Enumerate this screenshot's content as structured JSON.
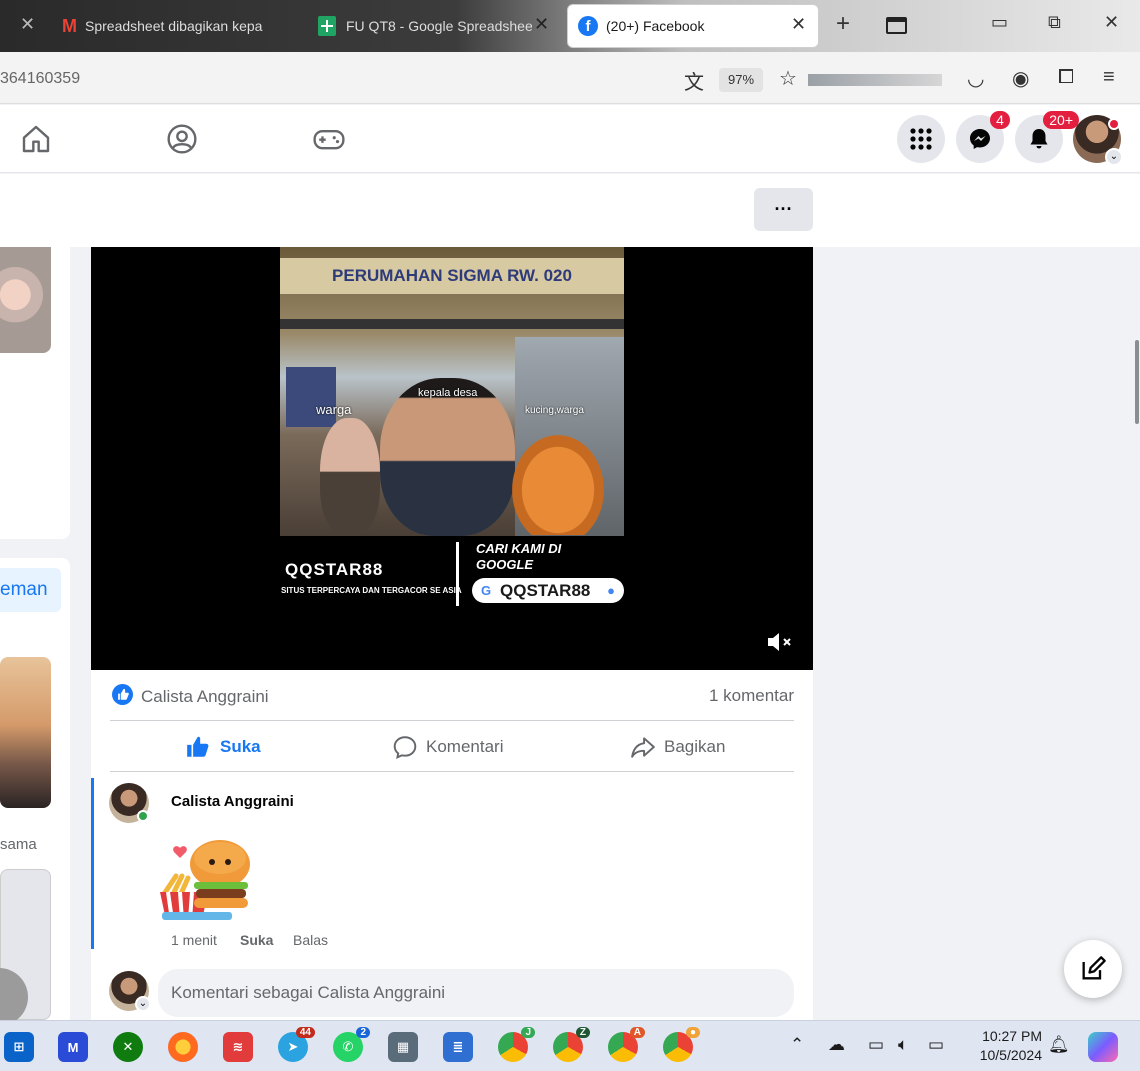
{
  "browser": {
    "tabs": [
      {
        "title": "Spreadsheet dibagikan kepa",
        "active": false
      },
      {
        "title": "FU QT8 - Google Spreadshee",
        "active": false
      },
      {
        "title": "(20+) Facebook",
        "active": true
      }
    ],
    "url": "364160359",
    "zoom": "97%"
  },
  "fbnav": {
    "messenger_badge": "4",
    "notifications_badge": "20+"
  },
  "more_label": "···",
  "left": {
    "teman_label": "eman",
    "sama_label": "sama"
  },
  "video": {
    "sign_text": "PERUMAHAN SIGMA RW. 020",
    "label_warga": "warga",
    "label_kepala": "kepala desa",
    "label_kucing": "kucing,warga",
    "brand_logo": "QQSTAR88",
    "brand_tagline": "SITUS TERPERCAYA DAN TERGACOR SE ASIA",
    "cta": "CARI KAMI DI GOOGLE",
    "search_text": "QQSTAR88"
  },
  "post": {
    "reactor_name": "Calista Anggraini",
    "comment_count": "1 komentar",
    "actions": {
      "like": "Suka",
      "comment": "Komentari",
      "share": "Bagikan"
    },
    "colors": {
      "accent": "#1877f2",
      "muted": "#65676b"
    }
  },
  "comment": {
    "author": "Calista Anggraini",
    "time": "1 menit",
    "like": "Suka",
    "reply": "Balas",
    "input_placeholder": "Komentari sebagai Calista Anggraini"
  },
  "taskbar": {
    "telegram_badge": "44",
    "whatsapp_badge": "2",
    "chrome_profiles": [
      "J",
      "Z",
      "A"
    ],
    "time": "10:27 PM",
    "date": "10/5/2024"
  }
}
